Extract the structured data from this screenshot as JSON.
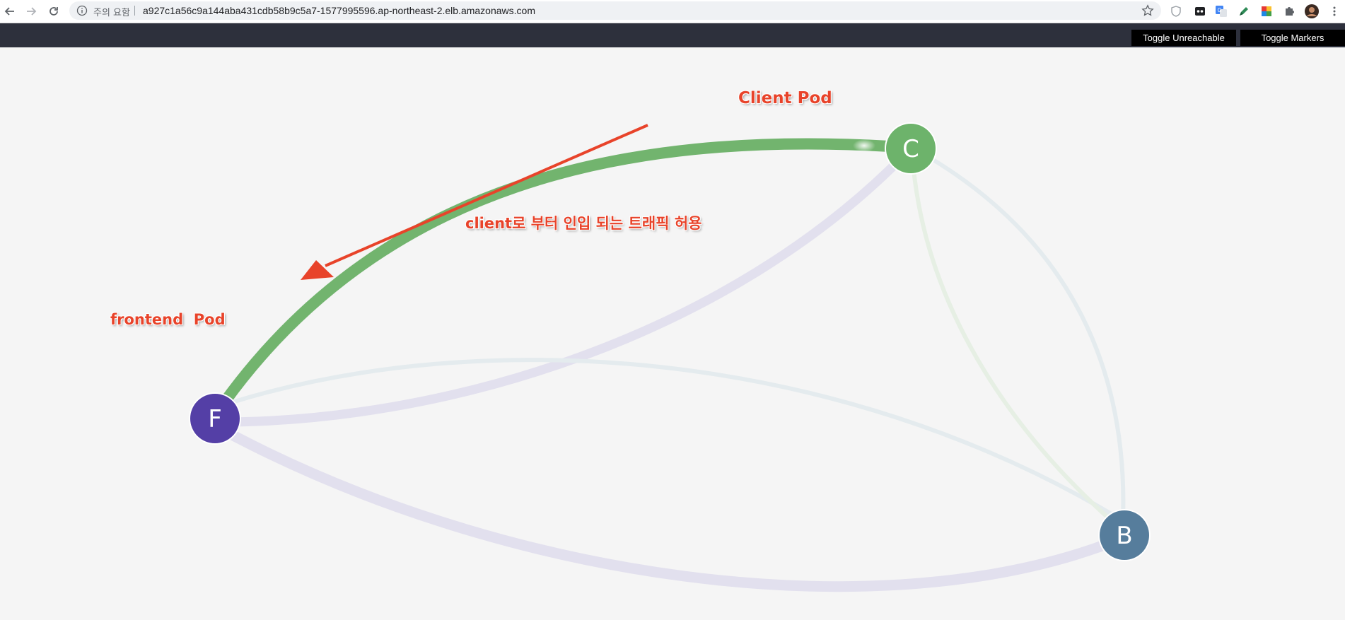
{
  "browser": {
    "security_label": "주의 요함",
    "url": "a927c1a56c9a144aba431cdb58b9c5a7-1577995596.ap-northeast-2.elb.amazonaws.com"
  },
  "toolbar": {
    "toggle_unreachable": "Toggle Unreachable",
    "toggle_markers": "Toggle Markers"
  },
  "graph": {
    "nodes": [
      {
        "id": "C",
        "label": "C",
        "color": "#6db36b"
      },
      {
        "id": "F",
        "label": "F",
        "color": "#543fa6"
      },
      {
        "id": "B",
        "label": "B",
        "color": "#567d9c"
      }
    ]
  },
  "annotations": {
    "client_pod": "Client Pod",
    "frontend_pod": "frontend  Pod",
    "traffic_note": "client로 부터 인입 되는 트래픽 허용"
  },
  "colors": {
    "annotation": "#e8432a",
    "allowed_edge": "#6db36b",
    "faded_edge": "#dcdcea",
    "app_bar": "#2d303c"
  }
}
